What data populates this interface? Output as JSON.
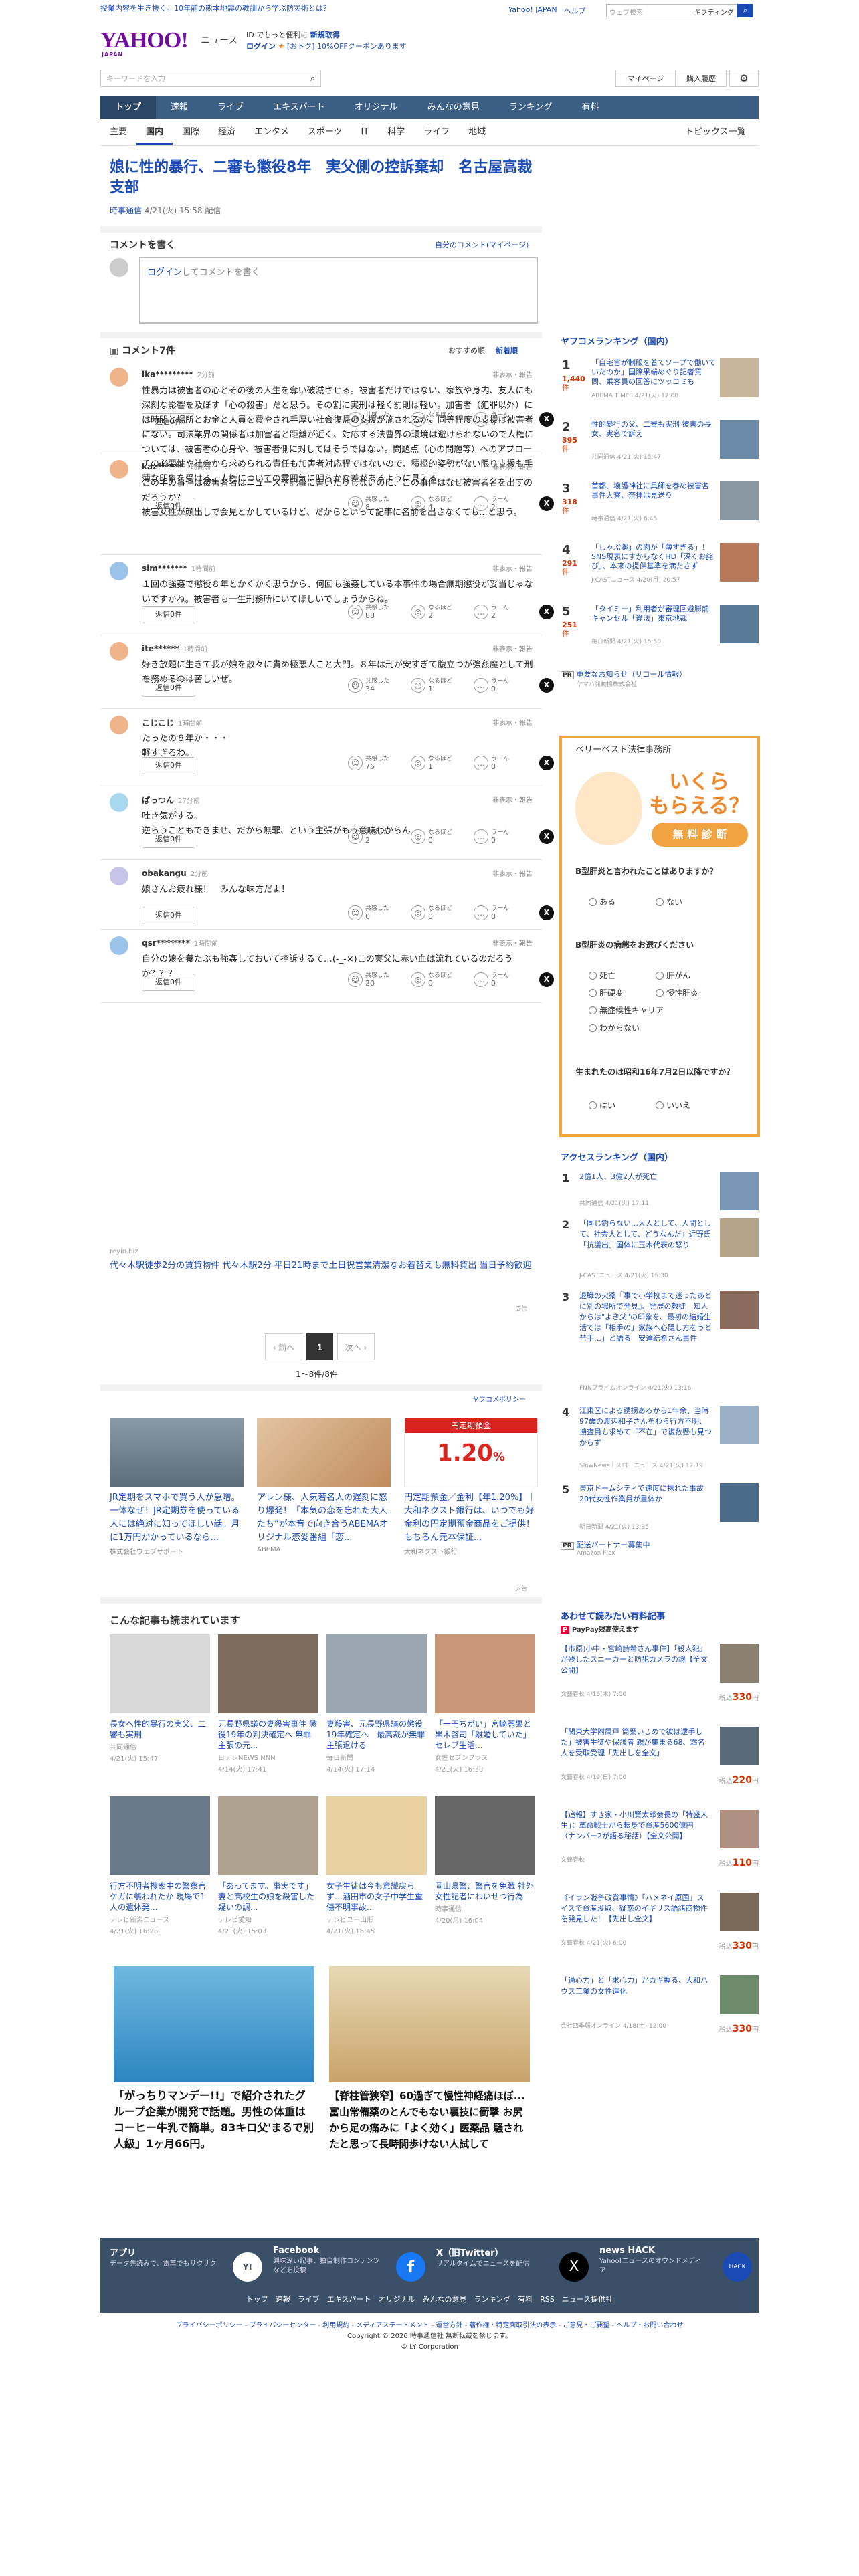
{
  "promo": "授業内容を生き抜く。10年前の熊本地震の教訓から学ぶ防災術とは？",
  "top_links": [
    "Yahoo! JAPAN",
    "ヘルプ"
  ],
  "top_search": {
    "placeholder": "ウェブ検索",
    "suggest": "ギフティング"
  },
  "brand": {
    "logo": "YAHOO!",
    "japan": "JAPAN",
    "service": "ニュース"
  },
  "register": {
    "line1": "ID でもっと便利に",
    "line1b": "新規取得",
    "line2": "ログイン",
    "line2b": "[おトク]",
    "line2c": "10%OFFクーポンあります"
  },
  "search": {
    "placeholder": "キーワードを入力"
  },
  "toolbar": {
    "mypage": "マイページ",
    "history": "購入履歴"
  },
  "gnav": [
    "トップ",
    "速報",
    "ライブ",
    "エキスパート",
    "オリジナル",
    "みんなの意見",
    "ランキング",
    "有料"
  ],
  "snav": [
    "主要",
    "国内",
    "国際",
    "経済",
    "エンタメ",
    "スポーツ",
    "IT",
    "科学",
    "ライフ",
    "地域"
  ],
  "topics_list": "トピックス一覧",
  "article": {
    "title": "娘に性的暴行、二審も懲役8年　実父側の控訴棄却　名古屋高裁支部",
    "source": "時事通信",
    "date": "4/21(火) 15:58 配信"
  },
  "comment_form": {
    "heading": "コメントを書く",
    "mine": "自分のコメント(マイページ)",
    "login": "ログイン",
    "placeholder": "してコメントを書く"
  },
  "comments_head": {
    "count": "コメント7件",
    "sort_recommended": "おすすめ順",
    "sort_new": "新着順"
  },
  "comments": [
    {
      "user": "ika*********",
      "time": "2分前",
      "text": "性暴力は被害者の心とその後の人生を奪い破滅させる。被害者だけではない、家族や身内、友人にも深刻な影響を及ぼす「心の殺害」だと思う。その割に実刑は軽く罰則は軽い。加害者（犯罪以外）には時間と場所とお金と人員を費やされ手厚い社会復帰の支援が施されるが、同等程度の支援は被害者にない。司法業界の関係者は加害者と距離が近く、対応する法曹界の環境は避けられないので人権については、被害者の心身や、被害者側に対してはそうではない。問題点（心の問題等）へのアプローチの必要性や社会から求められる責任も加害者対応程ではないので、積極的姿勢がない限り支援も手薄な印象を受ける。人権についての雰囲気に明らかな差があるように見える。",
      "replies": "返信0件",
      "k": "2",
      "n": "0",
      "u": "0",
      "ava": "#f0b48a"
    },
    {
      "user": "kaz******",
      "time": "1時間前",
      "text": "この手の事件は被害者名はニュースや記事に書いたりしないのに、この事件はなぜ被害者名を出すのだろうか？\n被害女性が顔出しで会見とかしているけど、だからといって記事に名前を出さなくても…と思う。",
      "replies": "返信0件",
      "k": "8",
      "n": "4",
      "u": "2",
      "ava": "#f0b48a"
    },
    {
      "user": "sim*******",
      "time": "1時間前",
      "text": "１回の強姦で懲役８年とかくかく思うから、何回も強姦している本事件の場合無期懲役が妥当じゃないですかね。被害者も一生刑務所にいてほしいでしょうからね。",
      "replies": "返信0件",
      "k": "88",
      "n": "2",
      "u": "2",
      "ava": "#9cc4ea"
    },
    {
      "user": "ite******",
      "time": "1時間前",
      "text": "好き放題に生きて我が娘を散々に貴め極悪人こと大門。８年は刑が安すぎて腹立つが強姦魔として刑を務めるのは苦しいぜ。",
      "replies": "返信0件",
      "k": "34",
      "n": "1",
      "u": "0",
      "ava": "#f0b48a"
    },
    {
      "user": "こじこじ",
      "time": "1時間前",
      "text": "たったの８年か・・・\n軽すぎるわ。",
      "replies": "返信0件",
      "k": "76",
      "n": "1",
      "u": "0",
      "ava": "#f0b48a"
    },
    {
      "user": "ぱっつん",
      "time": "27分前",
      "text": "吐き気がする。\n逆らうこともできませ、だから無罪、という主張がもう意味わからん",
      "replies": "返信0件",
      "k": "2",
      "n": "0",
      "u": "0",
      "ava": "#a8d8f0"
    },
    {
      "user": "obakangu",
      "time": "2分前",
      "text": "娘さんお疲れ様！　みんな味方だよ！",
      "replies": "返信0件",
      "k": "0",
      "n": "0",
      "u": "0",
      "ava": "#c8c4ea"
    },
    {
      "user": "qsr********",
      "time": "1時間前",
      "text": "自分の娘を養たぶも強姦しておいて控訴するて…(-_-×)この実父に赤い血は流れているのだろうか？？？",
      "replies": "返信0件",
      "k": "20",
      "n": "0",
      "u": "0",
      "ava": "#9cc4ea"
    }
  ],
  "labels": {
    "flag": "非表示・報告",
    "kyokan": "共感した",
    "naruhodo": "なるほど",
    "uun": "うーん",
    "ad": "広告"
  },
  "inline_ad": {
    "source": "reyin.biz",
    "text": "代々木駅徒歩2分の賃貸物件 代々木駅2分 平日21時まで土日祝営業清潔なお着替えも無料貸出 当日予約歓迎"
  },
  "pager": {
    "prev": "前へ",
    "current": "1",
    "next": "次へ",
    "count": "1〜8件/8件"
  },
  "yapolicy": "ヤフコメポリシー",
  "ads3": [
    {
      "title": "JR定期をスマホで買う人が急増。一体なぜ！JR定期券を使っている人には絶対に知ってほしい話。月に1万円かかっているなら...",
      "sponsor": "株式会社ウェブサポート"
    },
    {
      "title": "アレン様、人気若名人の遅刻に怒り爆発！「本気の恋を忘れた大人たち”が本音で向き合うABEMAオリジナル恋愛番組「恋...",
      "sponsor": "ABEMA"
    },
    {
      "title": "円定期預金／金利【年1.20%】｜大和ネクスト銀行は、いつでも好金利の円定期預金商品をご提供！もちろん元本保証...",
      "sponsor": "大和ネクスト銀行"
    }
  ],
  "ad_rate": {
    "head": "円定期預金",
    "rate": "1.20",
    "unit": "%"
  },
  "related": {
    "heading": "こんな記事も読まれています",
    "items": [
      {
        "title": "長女へ性的暴行の実父、二審も実刑",
        "meta": "共同通信",
        "date": "4/21(火) 15:47"
      },
      {
        "title": "元長野県議の妻殺害事件 懲役19年の判決確定へ 無罪主張の元...",
        "meta": "日テレNEWS NNN",
        "date": "4/14(火) 17:41"
      },
      {
        "title": "妻殺害、元長野県議の懲役19年確定へ　最高裁が無罪主張退ける",
        "meta": "毎日新聞",
        "date": "4/14(火) 17:14"
      },
      {
        "title": "「一円ちがい」宮崎麗果と黒木啓司「離婚していた」セレブ生活...",
        "meta": "女性セブンプラス",
        "date": "4/21(火) 16:30"
      },
      {
        "title": "行方不明者捜索中の警察官ケガに襲われたか 現場で1人の遺体発...",
        "meta": "テレビ新潟ニュース",
        "date": "4/21(火) 16:28"
      },
      {
        "title": "「あってます。事実です」妻と高校生の娘を殺害した疑いの調...",
        "meta": "テレビ愛知",
        "date": "4/21(火) 15:03"
      },
      {
        "title": "女子生徒は今も意識戻らず…酒田市の女子中学生重傷不明事故...",
        "meta": "テレビユー山形",
        "date": "4/21(火) 16:45"
      },
      {
        "title": "岡山県警、警官を免職 社外　女性記者にわいせつ行為",
        "meta": "時事通信",
        "date": "4/20(月) 16:04"
      }
    ]
  },
  "bigads": [
    {
      "title": "「がっちりマンデー!!」で紹介されたグループ企業が開発で話題。男性の体重はコーヒー牛乳で簡単。83キロ父'まるで別人級」1ヶ月66円。"
    },
    {
      "title": "【脊柱管狭窄】60過ぎて慢性神経痛ほぼ... 富山常備薬のとんでもない裏技に衝撃 お尻から足の痛みに「よく効く」医薬品 騒されたと思って長時間歩けない人試して"
    }
  ],
  "ranking": {
    "heading": "ヤフコメランキング（国内）",
    "items": [
      {
        "n": "1",
        "count": "1,440",
        "title": "「自宅官が制服を着てソープで働いていたのか」国際果端めぐり記者質問、乗客員の回答にツッコミも",
        "meta": "ABEMA TIMES",
        "date": "4/21(火) 17:00"
      },
      {
        "n": "2",
        "count": "395",
        "title": "性的暴行の父、二審も実刑 被害の長女、実名で訴え",
        "meta": "共同通信",
        "date": "4/21(火) 15:47"
      },
      {
        "n": "3",
        "count": "318",
        "title": "首都、壊護神社に具師を巻め被害各事件大察、奈拝は見送り",
        "meta": "時事通信",
        "date": "4/21(火) 6:45"
      },
      {
        "n": "4",
        "count": "291",
        "title": "「しゃぶ薬」の肉が「薄すぎる」！ SNS現表にすからなくHD「深くお詫び」、本来の提供基準を満たさず",
        "meta": "J-CASTニュース",
        "date": "4/20(月) 20:57"
      },
      {
        "n": "5",
        "count": "251",
        "title": "「タイミー」利用者が審理回避膨前キャンセル「違法」東京地裁",
        "meta": "毎日新聞",
        "date": "4/21(火) 15:50"
      }
    ],
    "pr": {
      "title": "重要なお知らせ（リコール情報）",
      "meta": "ヤマハ発動機株式会社"
    },
    "unit": "件"
  },
  "quiz_ad": {
    "brand": "ベリーベスト法律事務所",
    "big": "いくら\nもらえる？",
    "pill": "無 料 診 断",
    "q1": "B型肝炎と言われたことはありますか？",
    "q1a": [
      "ある",
      "ない"
    ],
    "q2": "B型肝炎の病態をお選びください",
    "q2a": [
      "死亡",
      "肝がん",
      "肝硬変",
      "慢性肝炎",
      "無症候性キャリア",
      "わからない"
    ],
    "q3": "生まれたのは昭和16年7月2日以降ですか？",
    "q3a": [
      "はい",
      "いいえ"
    ]
  },
  "access": {
    "heading": "アクセスランキング（国内）",
    "items": [
      {
        "n": "1",
        "title": "2億1人、3億2人が死亡",
        "meta": "共同通信",
        "date": "4/21(火) 17:11"
      },
      {
        "n": "2",
        "title": "「同じ釣らない…大人として、人間として、社会人として、どうなんだ」近野氏「抗議出」国体に玉木代表の怒り",
        "meta": "J-CASTニュース",
        "date": "4/21(火) 15:30"
      },
      {
        "n": "3",
        "title": "退職の火薬『事で小学校まで迷ったあとに別の場所で発見』、発展の教徒　知人からは\"よき父\"の印象を、最初の結婚生活では「相手の」家族へ心隠し方をうと苦手…」と語る　安達結希さん事件",
        "meta": "FNNプライムオンライン",
        "date": "4/21(火) 13:16"
      },
      {
        "n": "4",
        "title": "江東区による誘拐あるから1年余、当時97歳の渡辺和子さんをわら行方不明、捜査員も求めて「不在」で複数懸も見つからず",
        "meta": "SlowNews｜スローニュース",
        "date": "4/21(火) 17:19"
      },
      {
        "n": "5",
        "title": "東京ドームシティで速度に抹れた事故　20代女性作業員が重体か",
        "meta": "朝日新聞",
        "date": "4/21(火) 13:35"
      }
    ],
    "pr": {
      "title": "配送パートナー募集中",
      "meta": "Amazon Flex"
    }
  },
  "paid": {
    "heading": "あわせて読みたい有料記事",
    "badge": "PayPay残高使えます",
    "items": [
      {
        "title": "【市原]小中・宮崎詩希さん事件】「殺人犯」が残したスニーカーと防犯カメラの謎【全文公開】",
        "meta": "文藝春秋",
        "date": "4/16(木) 7:00",
        "price": "330"
      },
      {
        "title": "「関東大学附属戸 筒葉いじめで被は逮手した」被害生徒や保護者 親が集まる68、霜名人を受取受理「先出しを全文」",
        "meta": "文藝春秋",
        "date": "4/19(日) 7:00",
        "price": "220"
      },
      {
        "title": "【追報】すき家・小川賢太郎会長の「特盛人生」：革命戦士から転身で資産5600億円（ナンバー2が語る秘話）【全文公開】",
        "meta": "文藝春秋",
        "date": "",
        "price": "110"
      },
      {
        "title": "《イラン戦争政賞事情》「ハメネイ原国」スイスで資産没取、疑惑のイギリス語諸商物件を発見した！【先出し全文】",
        "meta": "文藝春秋",
        "date": "4/21(火) 6:00",
        "price": "330"
      },
      {
        "title": "「過心力」と「求心力」がカギ握る、大和ハウス工業の女性進化",
        "meta": "会社四季報オンライン",
        "date": "4/18(土) 12:00",
        "price": "330"
      }
    ],
    "unit": "円"
  },
  "footer": {
    "blocks": [
      {
        "h": "アプリ",
        "d": "データ先読みで、電車でもサクサク"
      },
      {
        "h": "Facebook",
        "d": "興味深い記事、独自制作コンテンツなどを投稿"
      },
      {
        "h": "X（旧Twitter）",
        "d": "リアルタイムでニュースを配信"
      },
      {
        "h": "news HACK",
        "d": "Yahoo!ニュースのオウンドメディア"
      }
    ],
    "links": "トップ　速報　ライブ　エキスパート　オリジナル　みんなの意見　ランキング　有料　RSS　ニュース提供社"
  },
  "legal": {
    "line1": "プライバシーポリシー - プライバシーセンター - 利用規約 - メディアステートメント - 運営方針 - 著作権・特定商取引法の表示 - ご意見・ご要望 - ヘルプ・お問い合わせ",
    "copy1": "Copyright © 2026 時事通信社 無断転載を禁じます。",
    "copy2": "© LY Corporation"
  }
}
